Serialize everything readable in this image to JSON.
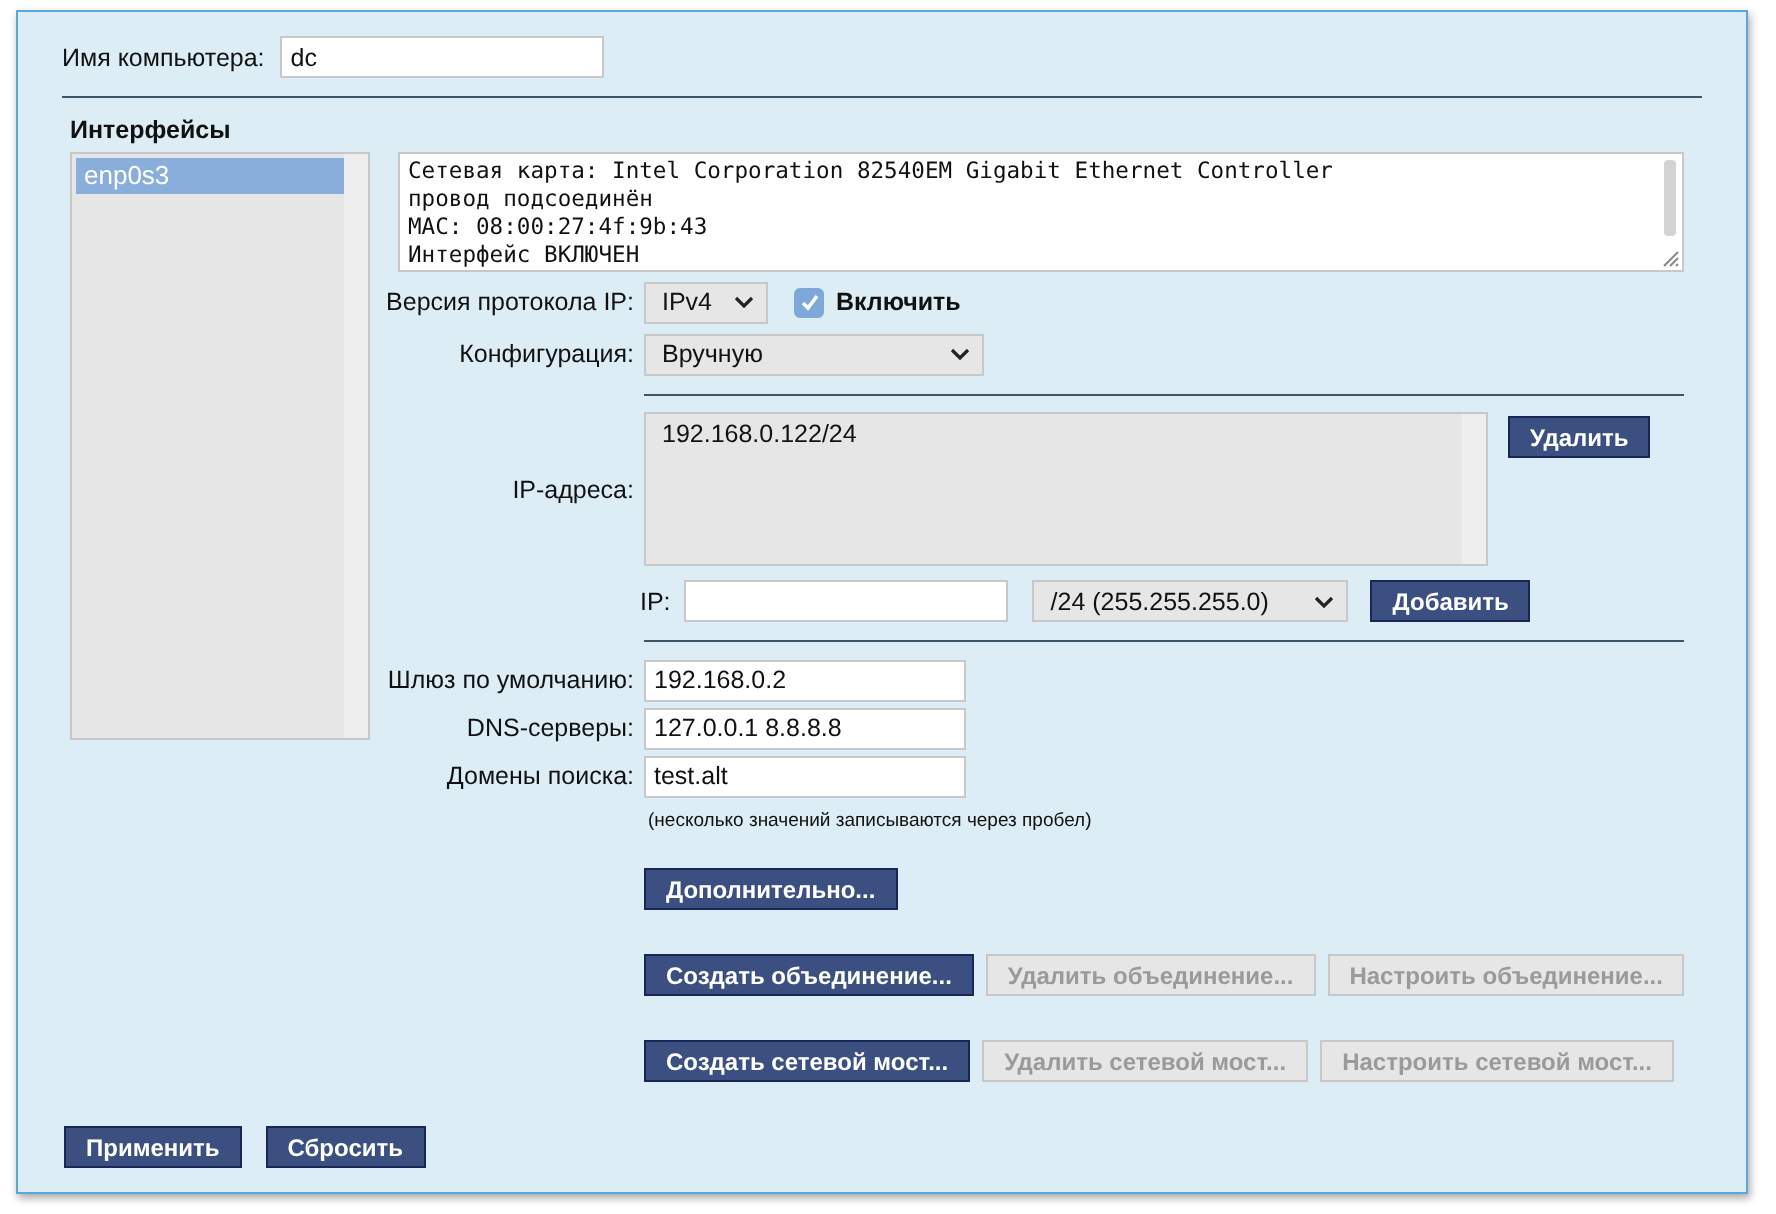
{
  "hostname": {
    "label": "Имя компьютера:",
    "value": "dc"
  },
  "interfaces": {
    "title": "Интерфейсы",
    "items": [
      {
        "name": "enp0s3",
        "selected": true
      }
    ]
  },
  "info_lines": [
    "Сетевая карта: Intel Corporation 82540EM Gigabit Ethernet Controller",
    "провод подсоединён",
    "MAC: 08:00:27:4f:9b:43",
    "Интерфейс ВКЛЮЧЕН"
  ],
  "ip_version": {
    "label": "Версия протокола IP:",
    "value": "IPv4"
  },
  "enable": {
    "label": "Включить",
    "checked": true
  },
  "configuration": {
    "label": "Конфигурация:",
    "value": "Вручную"
  },
  "ip_addresses": {
    "label": "IP-адреса:",
    "items": [
      {
        "text": "192.168.0.122/24",
        "selected": false
      }
    ],
    "delete_button": "Удалить"
  },
  "ip_entry": {
    "label": "IP:",
    "mask": "/24 (255.255.255.0)",
    "add_button": "Добавить"
  },
  "fields": [
    {
      "label": "Шлюз по умолчанию:",
      "value": "192.168.0.2"
    },
    {
      "label": "DNS-серверы:",
      "value": "127.0.0.1 8.8.8.8"
    },
    {
      "label": "Домены поиска:",
      "value": "test.alt"
    }
  ],
  "hint": "(несколько значений записываются через пробел)",
  "more_button": "Дополнительно...",
  "button_rows": [
    [
      {
        "label": "Создать объединение...",
        "disabled": false
      },
      {
        "label": "Удалить объединение...",
        "disabled": true
      },
      {
        "label": "Настроить объединение...",
        "disabled": true
      }
    ],
    [
      {
        "label": "Создать сетевой мост...",
        "disabled": false
      },
      {
        "label": "Удалить сетевой мост...",
        "disabled": true
      },
      {
        "label": "Настроить сетевой мост...",
        "disabled": true
      }
    ]
  ],
  "footer_buttons": [
    {
      "label": "Применить"
    },
    {
      "label": "Сбросить"
    }
  ]
}
